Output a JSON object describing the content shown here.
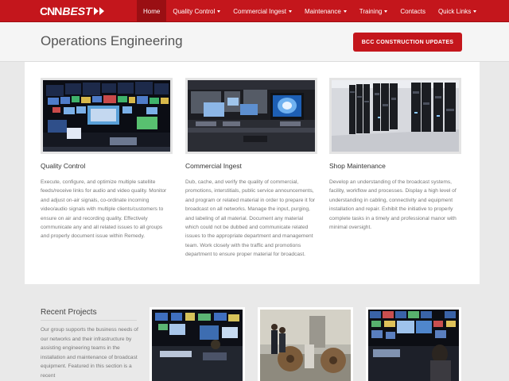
{
  "brand": {
    "logo_text_1": "CNN",
    "logo_text_2": "BEST",
    "accent": "#c4161c"
  },
  "nav": {
    "items": [
      {
        "label": "Home",
        "active": true,
        "dropdown": false
      },
      {
        "label": "Quality Control",
        "active": false,
        "dropdown": true
      },
      {
        "label": "Commercial Ingest",
        "active": false,
        "dropdown": true
      },
      {
        "label": "Maintenance",
        "active": false,
        "dropdown": true
      },
      {
        "label": "Training",
        "active": false,
        "dropdown": true
      },
      {
        "label": "Contacts",
        "active": false,
        "dropdown": false
      },
      {
        "label": "Quick Links",
        "active": false,
        "dropdown": true
      }
    ]
  },
  "header": {
    "title": "Operations Engineering",
    "cta_label": "BCC CONSTRUCTION UPDATES"
  },
  "services": [
    {
      "title": "Quality Control",
      "text": "Execute, configure, and optimize multiple satellite feeds/receive links for audio and video quality. Monitor and adjust on-air signals, co-ordinate incoming video/audio signals with multiple clients/customers to ensure on air and recording quality. Effectively communicate any and all related issues to all groups and properly document issue within Remedy."
    },
    {
      "title": "Commercial Ingest",
      "text": "Dub, cache, and verify the quality of commercial, promotions, interstitials, public service announcements, and program or related material in order to prepare it for broadcast on all networks. Manage the input, purging, and labeling of all material. Document any material which could not be dubbed and communicate related issues to the appropriate department and management team. Work closely with the traffic and promotions department to ensure proper material for broadcast."
    },
    {
      "title": "Shop Maintenance",
      "text": "Develop an understanding of the broadcast systems, facility, workflow and processes. Display a high level of understanding in cabling, connectivity and equipment installation and repair. Exhibit the initiative to properly complete tasks in a timely and professional manor with minimal oversight."
    }
  ],
  "projects": {
    "title": "Recent Projects",
    "text": "Our group supports the business needs of our networks and their infrastructure by assisting engineering teams in the installation and maintenance of broadcast equipment. Featured in this section is a recent"
  }
}
